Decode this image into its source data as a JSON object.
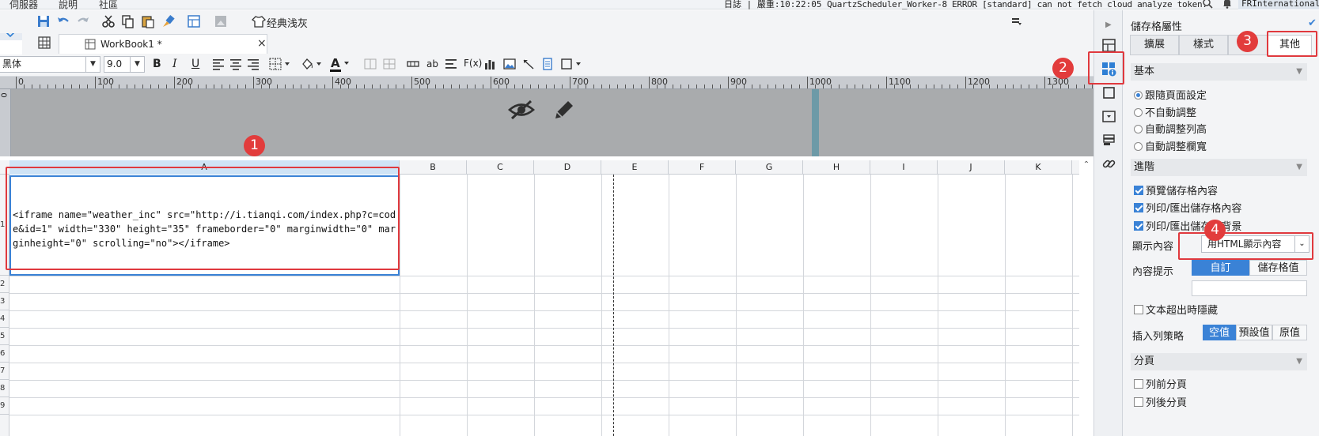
{
  "menubar": {
    "items": [
      "伺服器",
      "說明",
      "社區"
    ],
    "log_prefix": "日誌 | 嚴重:10:22:05",
    "log_message": "QuartzScheduler_Worker-8 ERROR [standard] can not fetch cloud analyze token.",
    "user": "FRInternational"
  },
  "toolbar": {
    "style_button": "经典浅灰"
  },
  "tabs": {
    "workbook_label": "WorkBook1 *",
    "close_glyph": "×"
  },
  "format": {
    "font_name": "黑体",
    "font_size": "9.0",
    "bold": "B",
    "italic": "I",
    "underline": "U",
    "text_color_letter": "A",
    "abc_label": "ab",
    "fx_label": "F(x)"
  },
  "ruler": {
    "labels": [
      "0",
      "100",
      "200",
      "300",
      "400",
      "500",
      "600",
      "700",
      "800",
      "900",
      "1000",
      "1100",
      "1200",
      "1300"
    ],
    "vertical_label": "0"
  },
  "grid": {
    "columns": [
      "A",
      "B",
      "C",
      "D",
      "E",
      "F",
      "G",
      "H",
      "I",
      "J",
      "K"
    ],
    "rows": [
      "1",
      "2",
      "3",
      "4",
      "5",
      "6",
      "7",
      "8",
      "9"
    ],
    "cell_A1": "<iframe name=\"weather_inc\" src=\"http://i.tianqi.com/index.php?c=code&id=1\" width=\"330\" height=\"35\" frameborder=\"0\" marginwidth=\"0\" marginheight=\"0\" scrolling=\"no\"></iframe>"
  },
  "panel": {
    "title": "儲存格屬性",
    "tabs": [
      "擴展",
      "樣式",
      "",
      "其他"
    ],
    "sections": {
      "basic": "基本",
      "advanced": "進階",
      "pagination": "分頁"
    },
    "basic_options": [
      "跟隨頁面設定",
      "不自動調整",
      "自動調整列高",
      "自動調整欄寬"
    ],
    "basic_selected": 0,
    "advanced_checks": [
      "預覽儲存格內容",
      "列印/匯出儲存格內容",
      "列印/匯出儲存格背景"
    ],
    "display_label": "顯示內容",
    "display_value": "用HTML顯示內容",
    "tooltip_label": "內容提示",
    "tooltip_options": [
      "自訂",
      "儲存格值"
    ],
    "hide_overflow": "文本超出時隱藏",
    "insert_label": "插入列策略",
    "insert_options": [
      "空值",
      "預設值",
      "原值"
    ],
    "page_break_before": "列前分頁",
    "page_break_after": "列後分頁"
  },
  "annotations": [
    "1",
    "2",
    "3",
    "4"
  ],
  "colors": {
    "accent": "#3a82d6",
    "annotation_red": "#e0393e",
    "canvas_gray": "#a9abad",
    "canvas_stripe": "#6d9aa7"
  }
}
